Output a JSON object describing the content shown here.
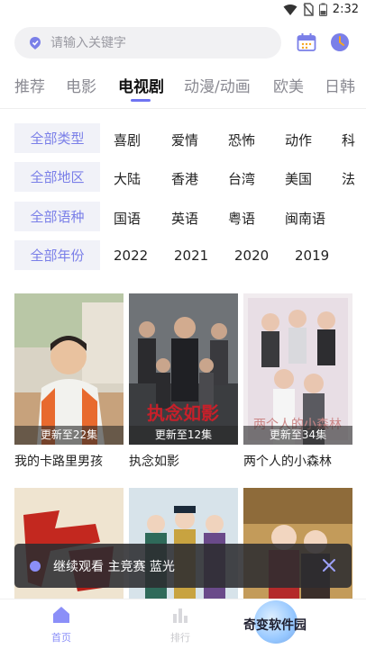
{
  "status": {
    "time": "2:32"
  },
  "search": {
    "placeholder": "请输入关键字"
  },
  "tabs": [
    {
      "label": "推荐"
    },
    {
      "label": "电影"
    },
    {
      "label": "电视剧",
      "active": true
    },
    {
      "label": "动漫/动画"
    },
    {
      "label": "欧美"
    },
    {
      "label": "日韩"
    }
  ],
  "filters": [
    {
      "all": "全部类型",
      "options": [
        "喜剧",
        "爱情",
        "恐怖",
        "动作",
        "科"
      ]
    },
    {
      "all": "全部地区",
      "options": [
        "大陆",
        "香港",
        "台湾",
        "美国",
        "法"
      ]
    },
    {
      "all": "全部语种",
      "options": [
        "国语",
        "英语",
        "粤语",
        "闽南语"
      ]
    },
    {
      "all": "全部年份",
      "options": [
        "2022",
        "2021",
        "2020",
        "2019"
      ]
    }
  ],
  "cards": [
    {
      "title": "我的卡路里男孩",
      "badge": "更新至22集"
    },
    {
      "title": "执念如影",
      "badge": "更新至12集"
    },
    {
      "title": "两个人的小森林",
      "badge": "更新至34集"
    }
  ],
  "cards_row2": [
    {
      "title": ""
    },
    {
      "title": ""
    },
    {
      "title": ""
    }
  ],
  "toast": {
    "message": "继续观看 主竞赛 蓝光"
  },
  "bottom_nav": [
    {
      "label": "首页",
      "active": true
    },
    {
      "label": "排行"
    }
  ],
  "watermark": "奇变软件园",
  "colors": {
    "accent": "#6f74f2",
    "filter_bg": "#f1f2f8",
    "filter_text": "#7a7fe8"
  }
}
